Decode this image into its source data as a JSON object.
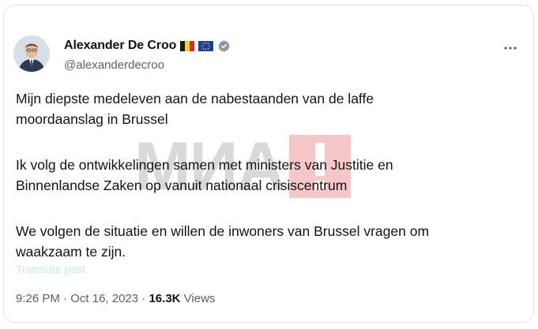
{
  "author": {
    "name": "Alexander De Croo",
    "handle": "@alexanderdecroo",
    "flags": [
      "belgium-flag-icon",
      "eu-flag-icon"
    ],
    "verified": true
  },
  "tweet": {
    "paragraphs": [
      "Mijn diepste medeleven aan de nabestaanden van de laffe\nmoordaanslag in Brussel",
      "Ik volg de ontwikkelingen samen met ministers van Justitie en\nBinnenlandse Zaken op vanuit nationaal crisiscentrum",
      "We volgen de situatie en willen de inwoners van Brussel vragen om\nwaakzaam te zijn."
    ],
    "translate_label": "Translate post",
    "time": "9:26 PM",
    "date": "Oct 16, 2023",
    "separator": "·",
    "views_count": "16.3K",
    "views_label": "Views"
  },
  "watermark": {
    "text": "МИА"
  },
  "colors": {
    "text": "#0f1419",
    "secondary": "#536471",
    "verified": "#829aab",
    "watermark_red": "#e43a3a"
  }
}
